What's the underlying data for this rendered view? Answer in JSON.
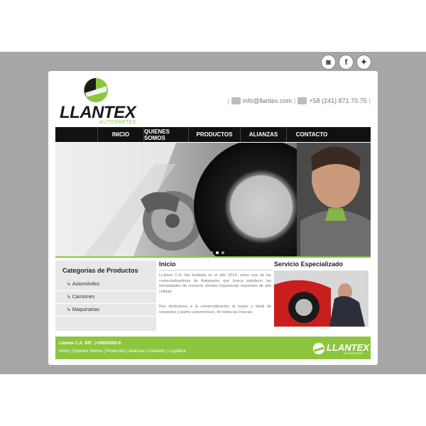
{
  "social": [
    {
      "icon": "instagram-icon",
      "glyph": "◙"
    },
    {
      "icon": "facebook-icon",
      "glyph": "f"
    },
    {
      "icon": "twitter-icon",
      "glyph": "✦"
    }
  ],
  "brand": {
    "name": "LLANTEX",
    "tagline": "AUTOPARTES"
  },
  "contact": {
    "email": "info@llantex.com",
    "phone": "+58 (241) 871.70.75"
  },
  "nav": [
    "INICIO",
    "QUIENES SOMOS",
    "PRODUCTOS",
    "ALIANZAS",
    "CONTACTO"
  ],
  "sidebar": {
    "title": "Categorías de Productos",
    "items": [
      "Automóviles",
      "Camiones",
      "Maquinarias"
    ]
  },
  "main": {
    "title": "Inicio",
    "p1": "LLantex C.A. fue fundada en el año 2014, como una de las comercializadoras de Autopartes que busca satisfacer las necesidades de nuestros clientes importando repuestos de alta calidad.",
    "p2": "Nos dedicamos a la comercialización al mayor y detal de repuestos y partes automotrices, de todas las marcas."
  },
  "service": {
    "title": "Servicio Especializado"
  },
  "footer": {
    "company": "Llantex C.A. RIF: J-00000000-0",
    "links": "Inicio | Quienes Somos | Productos | Alianzas | Contacto | Logística",
    "logo_text": "LLANTEX",
    "logo_sub": "AUTOPARTES"
  },
  "colors": {
    "accent": "#8cc63f",
    "nav_bg": "#111111",
    "frame": "#a6a6a6"
  }
}
